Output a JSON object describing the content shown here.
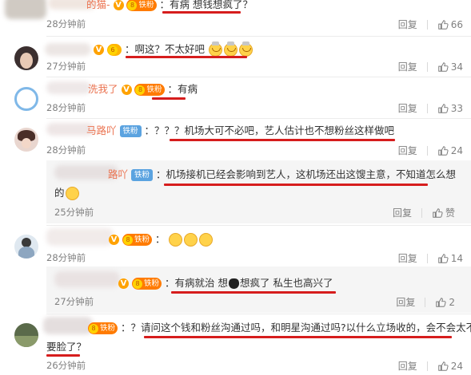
{
  "colors": {
    "underline": "#d61d1d",
    "name": "#eb7350",
    "meta": "#808080",
    "reply_bg": "#f5f5f5"
  },
  "icons": {
    "reply": "reply-label",
    "comment": "comment-bubble-icon",
    "like": "thumbs-up-icon"
  },
  "comments": [
    {
      "name": "的猫-",
      "badge": "铁粉",
      "sep": "：",
      "body": "有病 想钱想疯了？",
      "time": "28分钟前",
      "reply": "回复",
      "likes": "66"
    },
    {
      "name": "",
      "badge": "",
      "sep": "：",
      "body_before": "啊这？不太好吧",
      "time": "27分钟前",
      "reply": "回复",
      "likes": "34"
    },
    {
      "name": "洗我了",
      "badge": "铁粉",
      "sep": "：",
      "body": "有病",
      "time": "28分钟前",
      "reply": "回复",
      "likes": "33"
    },
    {
      "name": "马路吖",
      "badge": "铁粉",
      "sep": "：",
      "body": "？？？机场大可不必吧，艺人估计也不想粉丝这样做吧",
      "time": "28分钟前",
      "reply": "回复",
      "likes": "24"
    },
    {
      "name": "路吖",
      "badge": "铁粉",
      "sep": "：",
      "body": "机场接机已经会影响到艺人，这机场还出这馊主意，不知道怎么想",
      "body2": "的",
      "time": "25分钟前",
      "reply": "回复",
      "like_label": "赞"
    },
    {
      "name": "",
      "badge": "铁粉",
      "sep": "：",
      "time": "28分钟前",
      "reply": "回复",
      "likes": "14"
    },
    {
      "name": "",
      "badge": "铁粉",
      "sep": "：",
      "body_a": "有病就治 想",
      "body_b": "想疯了 私生也高兴了",
      "time": "27分钟前",
      "reply": "回复",
      "likes": "2"
    },
    {
      "name": "",
      "badge": "铁粉",
      "sep": "：",
      "body": "？请问这个钱和粉丝沟通过吗，和明星沟通过吗?以什么立场收的，会不会太不",
      "body2": "要脸了？",
      "time": "26分钟前",
      "reply": "回复",
      "likes": "24"
    }
  ]
}
